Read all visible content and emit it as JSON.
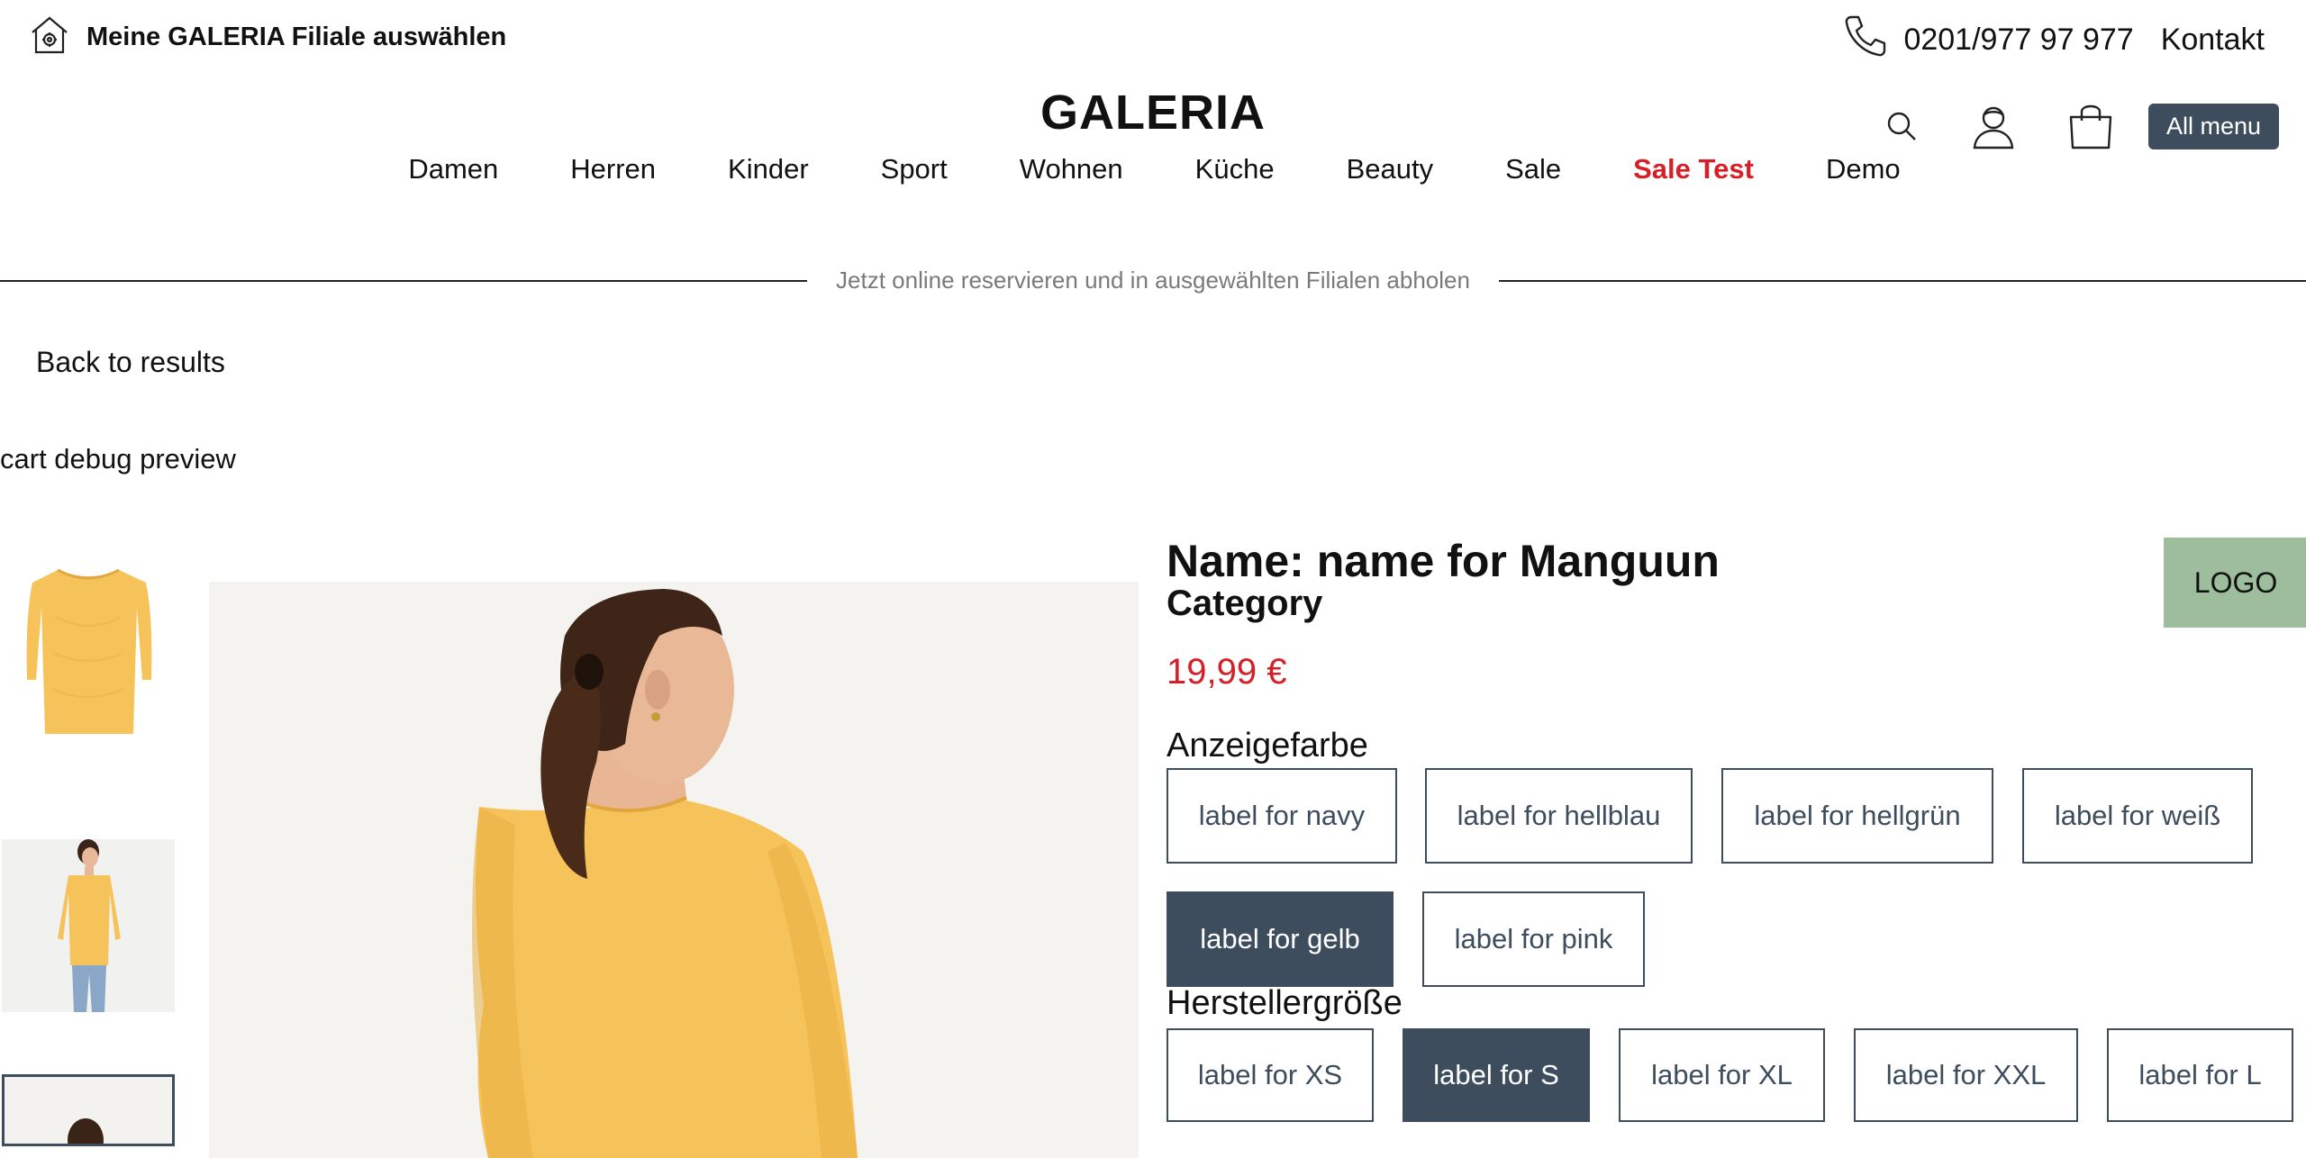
{
  "header": {
    "store_picker_label": "Meine GALERIA Filiale auswählen",
    "phone": "0201/977 97 977",
    "contact_label": "Kontakt",
    "brand": "GALERIA",
    "menu_button_label": "All menu",
    "icons": [
      "store-icon",
      "phone-icon",
      "search-icon",
      "account-icon",
      "cart-icon"
    ]
  },
  "nav": {
    "items": [
      {
        "label": "Damen"
      },
      {
        "label": "Herren"
      },
      {
        "label": "Kinder"
      },
      {
        "label": "Sport"
      },
      {
        "label": "Wohnen"
      },
      {
        "label": "Küche"
      },
      {
        "label": "Beauty"
      },
      {
        "label": "Sale"
      },
      {
        "label": "Sale Test"
      },
      {
        "label": "Demo"
      }
    ]
  },
  "banner": {
    "text": "Jetzt online reservieren und in ausgewählten Filialen abholen"
  },
  "back_link": "Back to results",
  "debug_label": "cart debug preview",
  "product": {
    "name": "Name: name for Manguun",
    "category": "Category",
    "price": "19,99 €",
    "logo_label": "LOGO",
    "color_group": {
      "label": "Anzeigefarbe",
      "options": [
        {
          "label": "label for navy",
          "selected": false
        },
        {
          "label": "label for hellblau",
          "selected": false
        },
        {
          "label": "label for hellgrün",
          "selected": false
        },
        {
          "label": "label for weiß",
          "selected": false
        },
        {
          "label": "label for gelb",
          "selected": true
        },
        {
          "label": "label for pink",
          "selected": false
        }
      ]
    },
    "size_group": {
      "label": "Herstellergröße",
      "options": [
        {
          "label": "label for XS",
          "selected": false
        },
        {
          "label": "label for S",
          "selected": true
        },
        {
          "label": "label for XL",
          "selected": false
        },
        {
          "label": "label for XXL",
          "selected": false
        },
        {
          "label": "label for L",
          "selected": false
        }
      ]
    }
  },
  "colors": {
    "accent": "#3d4d5d",
    "sale_red": "#d61f26",
    "logo_bg": "#9dbd9c",
    "sweater_yellow": "#f5c35a"
  }
}
